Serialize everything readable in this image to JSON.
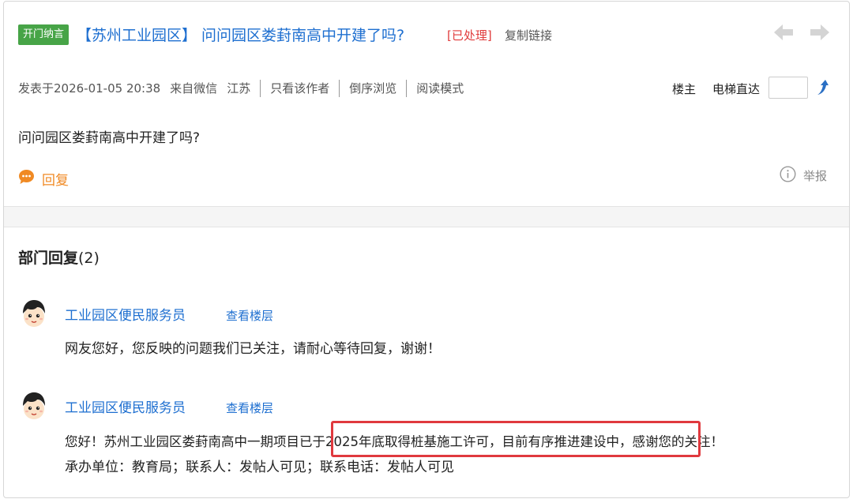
{
  "header": {
    "tag": "开门纳言",
    "region": "【苏州工业园区】",
    "title": "问问园区娄葑南高中开建了吗?",
    "status": "[已处理]",
    "copy_link": "复制链接"
  },
  "meta": {
    "posted": "发表于2026-01-05 20:38",
    "source": "来自微信",
    "location": "江苏",
    "only_author": "只看该作者",
    "reverse_order": "倒序浏览",
    "reading_mode": "阅读模式",
    "louzhu": "楼主",
    "elevator": "电梯直达",
    "floor_input_value": ""
  },
  "post": {
    "content": "问问园区娄葑南高中开建了吗?",
    "reply_label": "回复",
    "report_label": "举报"
  },
  "department": {
    "title": "部门回复",
    "count": "(2)",
    "replies": [
      {
        "name": "工业园区便民服务员",
        "view_floor": "查看楼层",
        "text": "网友您好，您反映的问题我们已关注，请耐心等待回复，谢谢！"
      },
      {
        "name": "工业园区便民服务员",
        "view_floor": "查看楼层",
        "text": "您好！苏州工业园区娄葑南高中一期项目已于2025年底取得桩基施工许可，目前有序推进建设中，感谢您的关注！",
        "text2": "承办单位：教育局；联系人：发帖人可见；联系电话：发帖人可见"
      }
    ]
  },
  "colors": {
    "link_blue": "#1e6fd0",
    "tag_green": "#47a447",
    "status_red": "#e03b3b",
    "reply_orange": "#f08a24",
    "highlight_red": "#e0393e"
  }
}
